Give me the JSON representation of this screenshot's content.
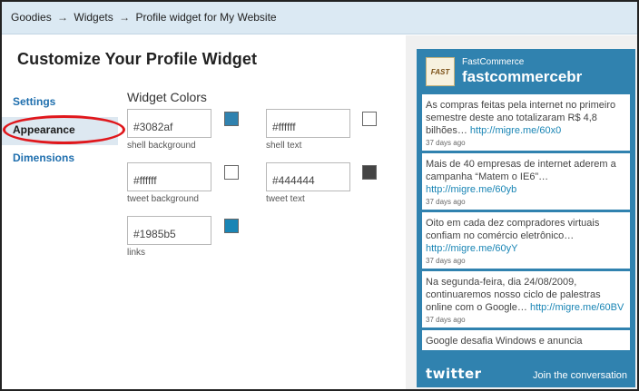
{
  "breadcrumb": {
    "items": [
      "Goodies",
      "Widgets",
      "Profile widget for My Website"
    ],
    "separator": "→"
  },
  "page_title": "Customize Your Profile Widget",
  "sidenav": {
    "items": [
      {
        "label": "Settings",
        "active": false
      },
      {
        "label": "Appearance",
        "active": true
      },
      {
        "label": "Dimensions",
        "active": false
      }
    ]
  },
  "widget_colors": {
    "heading": "Widget Colors",
    "fields": [
      {
        "label": "shell background",
        "value": "#3082af",
        "swatch": "#3082af"
      },
      {
        "label": "shell text",
        "value": "#ffffff",
        "swatch": "#ffffff"
      },
      {
        "label": "tweet background",
        "value": "#ffffff",
        "swatch": "#ffffff"
      },
      {
        "label": "tweet text",
        "value": "#444444",
        "swatch": "#444444"
      },
      {
        "label": "links",
        "value": "#1985b5",
        "swatch": "#1985b5"
      }
    ]
  },
  "highlight": {
    "color": "#e0171c"
  },
  "widget": {
    "logo_text": "FAST",
    "logo_icon": "fastcommerce-logo-icon",
    "name": "FastCommerce",
    "handle": "fastcommercebr",
    "tweets": [
      {
        "text": "As compras feitas pela internet no primeiro semestre deste ano totalizaram R$ 4,8 bilhões… ",
        "link": "http://migre.me/60x0",
        "time": "37 days ago"
      },
      {
        "text": "Mais de 40 empresas de internet aderem a campanha “Matem o IE6”… ",
        "link": "http://migre.me/60yb",
        "time": "37 days ago"
      },
      {
        "text": "Oito em cada dez compradores virtuais confiam no comércio eletrônico… ",
        "link": "http://migre.me/60yY",
        "time": "37 days ago"
      },
      {
        "text": "Na segunda-feira, dia 24/08/2009, continuaremos nosso ciclo de palestras online com o Google… ",
        "link": "http://migre.me/60BV",
        "time": "37 days ago"
      },
      {
        "text": "Google desafia Windows e anuncia",
        "link": "",
        "time": ""
      }
    ],
    "footer": {
      "logo_text": "twitter",
      "logo_icon": "twitter-logo-icon",
      "join_label": "Join the conversation"
    }
  }
}
